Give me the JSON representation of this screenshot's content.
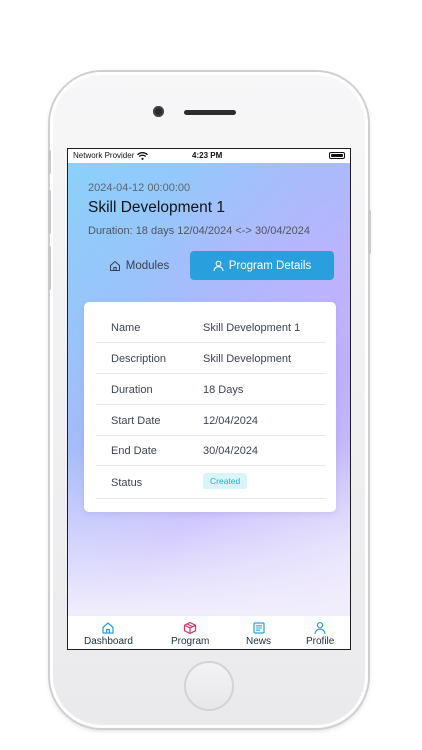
{
  "status_bar": {
    "carrier": "Network Provider",
    "time": "4:23 PM"
  },
  "header": {
    "date": "2024-04-12 00:00:00",
    "title": "Skill Development 1",
    "duration": "Duration: 18 days 12/04/2024 <-> 30/04/2024"
  },
  "tabs": {
    "modules_label": "Modules",
    "program_details_label": "Program Details",
    "active": "program_details",
    "active_color": "#2a9fde"
  },
  "details": {
    "rows": [
      {
        "label": "Name",
        "value": "Skill Development 1"
      },
      {
        "label": "Description",
        "value": "Skill Development"
      },
      {
        "label": "Duration",
        "value": "18 Days"
      },
      {
        "label": "Start Date",
        "value": "12/04/2024"
      },
      {
        "label": "End Date",
        "value": "30/04/2024"
      },
      {
        "label": "Status",
        "value": "Created"
      }
    ],
    "status_color": "#22b5c5"
  },
  "bottom_nav": {
    "items": [
      {
        "label": "Dashboard",
        "icon": "home-icon",
        "color": "#2a9fde"
      },
      {
        "label": "Program",
        "icon": "box-icon",
        "color": "#e0306a"
      },
      {
        "label": "News",
        "icon": "newspaper-icon",
        "color": "#2a9fde"
      },
      {
        "label": "Profile",
        "icon": "user-icon",
        "color": "#2a9fde"
      }
    ]
  }
}
